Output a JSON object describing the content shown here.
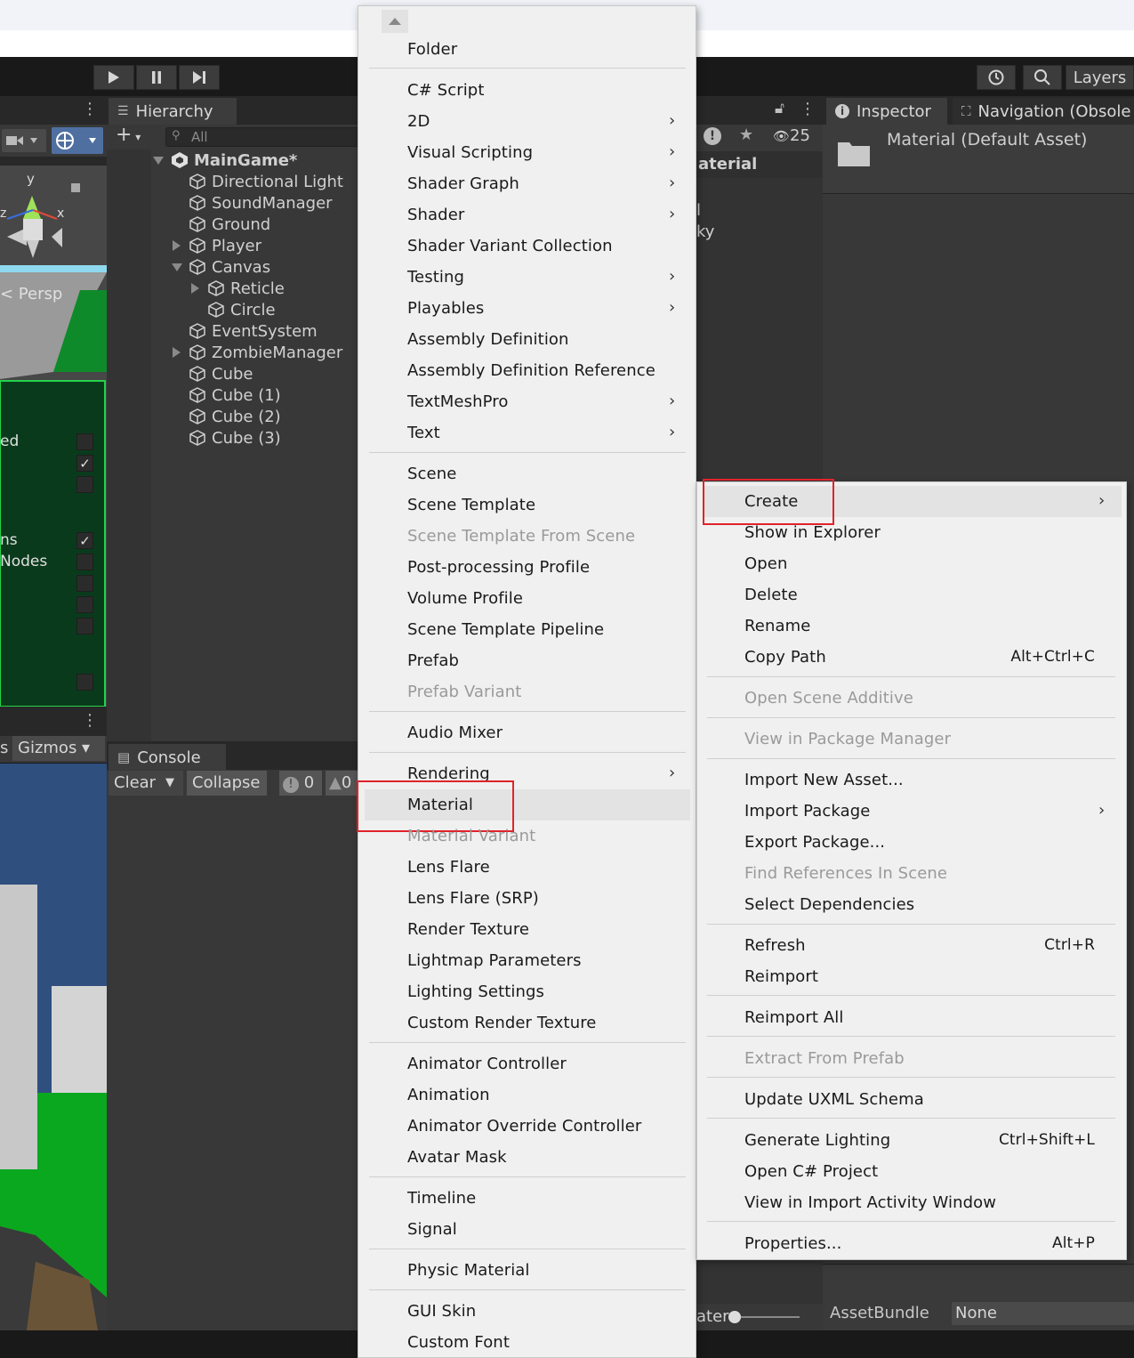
{
  "toolbar": {
    "play_icon": "play-icon",
    "pause_icon": "pause-icon",
    "step_icon": "step-icon",
    "history_icon": "history-icon",
    "search_icon": "search-icon",
    "layers_label": "Layers"
  },
  "scene": {
    "persp_label": "< Persp",
    "axis_y": "y",
    "axis_x": "x",
    "axis_z": "z",
    "overlay_labels": [
      "ed",
      "ns",
      "Nodes"
    ],
    "gizmos_label": "Gizmos",
    "gizmos_prefix": "s"
  },
  "hierarchy": {
    "tab_label": "Hierarchy",
    "search_placeholder": "All",
    "add_label": "+",
    "scene_name": "MainGame*",
    "items": [
      {
        "label": "Directional Light"
      },
      {
        "label": "SoundManager"
      },
      {
        "label": "Ground"
      },
      {
        "label": "Player"
      },
      {
        "label": "Canvas"
      },
      {
        "label": "Reticle"
      },
      {
        "label": "Circle"
      },
      {
        "label": "EventSystem"
      },
      {
        "label": "ZombieManager"
      },
      {
        "label": "Cube"
      },
      {
        "label": "Cube (1)"
      },
      {
        "label": "Cube (2)"
      },
      {
        "label": "Cube (3)"
      }
    ]
  },
  "console": {
    "tab_label": "Console",
    "clear_label": "Clear",
    "collapse_label": "Collapse",
    "error_count": "0",
    "warning_count": "0"
  },
  "project": {
    "breadcrumb_fragment": "aterial",
    "fragment_1": "l",
    "fragment_2": "ky",
    "hidden_count": "25",
    "slider_label": "ater"
  },
  "inspector": {
    "tab_label": "Inspector",
    "nav_tab_label": "Navigation (Obsole",
    "asset_title": "Material (Default Asset)",
    "assetbundle_label": "AssetBundle",
    "assetbundle_value": "None"
  },
  "create_menu": {
    "items": [
      {
        "label": "Folder",
        "submenu": false,
        "disabled": false
      },
      {
        "label": "C# Script",
        "submenu": false,
        "disabled": false
      },
      {
        "label": "2D",
        "submenu": true,
        "disabled": false
      },
      {
        "label": "Visual Scripting",
        "submenu": true,
        "disabled": false
      },
      {
        "label": "Shader Graph",
        "submenu": true,
        "disabled": false
      },
      {
        "label": "Shader",
        "submenu": true,
        "disabled": false
      },
      {
        "label": "Shader Variant Collection",
        "submenu": false,
        "disabled": false
      },
      {
        "label": "Testing",
        "submenu": true,
        "disabled": false
      },
      {
        "label": "Playables",
        "submenu": true,
        "disabled": false
      },
      {
        "label": "Assembly Definition",
        "submenu": false,
        "disabled": false
      },
      {
        "label": "Assembly Definition Reference",
        "submenu": false,
        "disabled": false
      },
      {
        "label": "TextMeshPro",
        "submenu": true,
        "disabled": false
      },
      {
        "label": "Text",
        "submenu": true,
        "disabled": false
      },
      {
        "label": "Scene",
        "submenu": false,
        "disabled": false
      },
      {
        "label": "Scene Template",
        "submenu": false,
        "disabled": false
      },
      {
        "label": "Scene Template From Scene",
        "submenu": false,
        "disabled": true
      },
      {
        "label": "Post-processing Profile",
        "submenu": false,
        "disabled": false
      },
      {
        "label": "Volume Profile",
        "submenu": false,
        "disabled": false
      },
      {
        "label": "Scene Template Pipeline",
        "submenu": false,
        "disabled": false
      },
      {
        "label": "Prefab",
        "submenu": false,
        "disabled": false
      },
      {
        "label": "Prefab Variant",
        "submenu": false,
        "disabled": true
      },
      {
        "label": "Audio Mixer",
        "submenu": false,
        "disabled": false
      },
      {
        "label": "Rendering",
        "submenu": true,
        "disabled": false
      },
      {
        "label": "Material",
        "submenu": false,
        "disabled": false,
        "highlighted": true
      },
      {
        "label": "Material Variant",
        "submenu": false,
        "disabled": true
      },
      {
        "label": "Lens Flare",
        "submenu": false,
        "disabled": false
      },
      {
        "label": "Lens Flare (SRP)",
        "submenu": false,
        "disabled": false
      },
      {
        "label": "Render Texture",
        "submenu": false,
        "disabled": false
      },
      {
        "label": "Lightmap Parameters",
        "submenu": false,
        "disabled": false
      },
      {
        "label": "Lighting Settings",
        "submenu": false,
        "disabled": false
      },
      {
        "label": "Custom Render Texture",
        "submenu": false,
        "disabled": false
      },
      {
        "label": "Animator Controller",
        "submenu": false,
        "disabled": false
      },
      {
        "label": "Animation",
        "submenu": false,
        "disabled": false
      },
      {
        "label": "Animator Override Controller",
        "submenu": false,
        "disabled": false
      },
      {
        "label": "Avatar Mask",
        "submenu": false,
        "disabled": false
      },
      {
        "label": "Timeline",
        "submenu": false,
        "disabled": false
      },
      {
        "label": "Signal",
        "submenu": false,
        "disabled": false
      },
      {
        "label": "Physic Material",
        "submenu": false,
        "disabled": false
      },
      {
        "label": "GUI Skin",
        "submenu": false,
        "disabled": false
      },
      {
        "label": "Custom Font",
        "submenu": false,
        "disabled": false
      }
    ],
    "scroll_up_icon": "scroll-up-arrow-icon"
  },
  "context_menu": {
    "items": [
      {
        "label": "Create",
        "submenu": true,
        "disabled": false,
        "shortcut": "",
        "highlighted": true
      },
      {
        "label": "Show in Explorer",
        "submenu": false,
        "disabled": false,
        "shortcut": ""
      },
      {
        "label": "Open",
        "submenu": false,
        "disabled": false,
        "shortcut": ""
      },
      {
        "label": "Delete",
        "submenu": false,
        "disabled": false,
        "shortcut": ""
      },
      {
        "label": "Rename",
        "submenu": false,
        "disabled": false,
        "shortcut": ""
      },
      {
        "label": "Copy Path",
        "submenu": false,
        "disabled": false,
        "shortcut": "Alt+Ctrl+C"
      },
      {
        "label": "Open Scene Additive",
        "submenu": false,
        "disabled": true,
        "shortcut": ""
      },
      {
        "label": "View in Package Manager",
        "submenu": false,
        "disabled": true,
        "shortcut": ""
      },
      {
        "label": "Import New Asset...",
        "submenu": false,
        "disabled": false,
        "shortcut": ""
      },
      {
        "label": "Import Package",
        "submenu": true,
        "disabled": false,
        "shortcut": ""
      },
      {
        "label": "Export Package...",
        "submenu": false,
        "disabled": false,
        "shortcut": ""
      },
      {
        "label": "Find References In Scene",
        "submenu": false,
        "disabled": true,
        "shortcut": ""
      },
      {
        "label": "Select Dependencies",
        "submenu": false,
        "disabled": false,
        "shortcut": ""
      },
      {
        "label": "Refresh",
        "submenu": false,
        "disabled": false,
        "shortcut": "Ctrl+R"
      },
      {
        "label": "Reimport",
        "submenu": false,
        "disabled": false,
        "shortcut": ""
      },
      {
        "label": "Reimport All",
        "submenu": false,
        "disabled": false,
        "shortcut": ""
      },
      {
        "label": "Extract From Prefab",
        "submenu": false,
        "disabled": true,
        "shortcut": ""
      },
      {
        "label": "Update UXML Schema",
        "submenu": false,
        "disabled": false,
        "shortcut": ""
      },
      {
        "label": "Generate Lighting",
        "submenu": false,
        "disabled": false,
        "shortcut": "Ctrl+Shift+L"
      },
      {
        "label": "Open C# Project",
        "submenu": false,
        "disabled": false,
        "shortcut": ""
      },
      {
        "label": "View in Import Activity Window",
        "submenu": false,
        "disabled": false,
        "shortcut": ""
      },
      {
        "label": "Properties...",
        "submenu": false,
        "disabled": false,
        "shortcut": "Alt+P"
      }
    ]
  },
  "colors": {
    "highlight_box": "#e0232a",
    "menu_bg": "#f0f0f0",
    "editor_bg": "#383838"
  }
}
